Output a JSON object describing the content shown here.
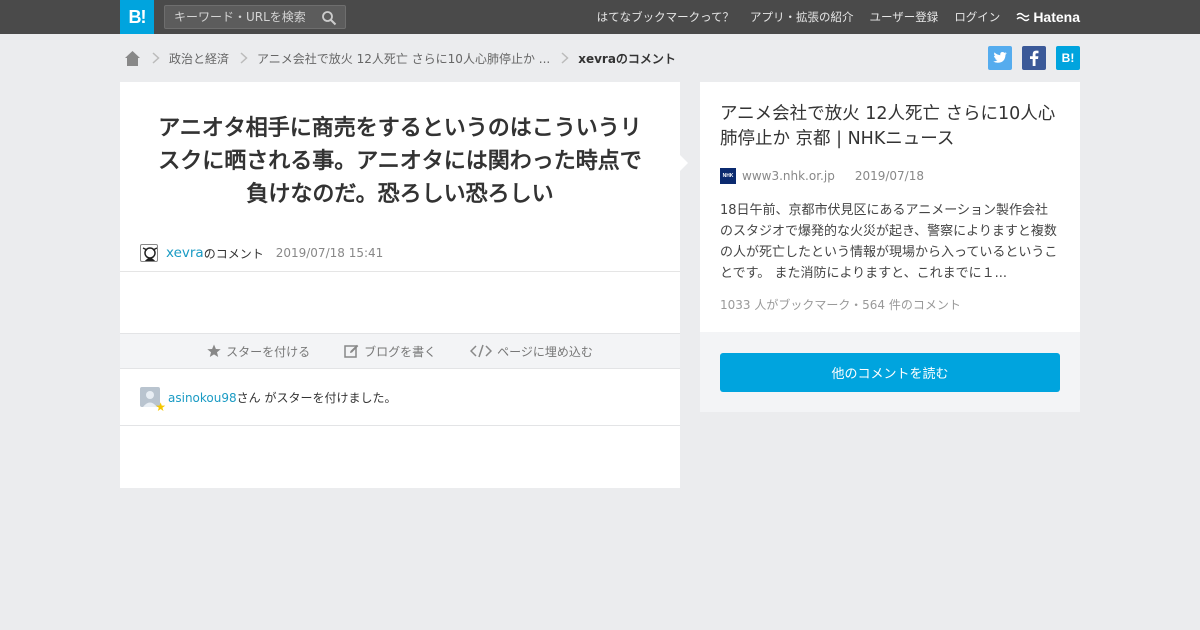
{
  "topbar": {
    "logo": "B!",
    "search_placeholder": "キーワード・URLを検索",
    "nav": [
      "はてなブックマークって？",
      "アプリ・拡張の紹介",
      "ユーザー登録",
      "ログイン"
    ],
    "brand": "Hatena"
  },
  "breadcrumb": {
    "items": [
      "政治と経済",
      "アニメ会社で放火 12人死亡 さらに10人心肺停止か ...",
      "xevraのコメント"
    ]
  },
  "share": {
    "twitter": "t",
    "facebook": "f",
    "hatena": "B!"
  },
  "comment": {
    "text": "アニオタ相手に商売をするというのはこういうリスクに晒される事。アニオタには関わった時点で負けなのだ。恐ろしい恐ろしい",
    "user": "xevra",
    "user_suffix": "のコメント",
    "timestamp": "2019/07/18 15:41"
  },
  "actions": {
    "star": "スターを付ける",
    "blog": "ブログを書く",
    "embed": "ページに埋め込む"
  },
  "stars": {
    "user": "asinokou98",
    "text": "さん がスターを付けました。"
  },
  "entry": {
    "title": "アニメ会社で放火 12人死亡 さらに10人心肺停止か 京都 | NHKニュース",
    "domain": "www3.nhk.or.jp",
    "date": "2019/07/18",
    "favicon": "NHK",
    "summary": "18日午前、京都市伏見区にあるアニメーション製作会社のスタジオで爆発的な火災が起き、警察によりますと複数の人が死亡したという情報が現場から入っているということです。 また消防によりますと、これまでに１...",
    "counts": "1033 人がブックマーク・564 件のコメント",
    "read_more": "他のコメントを読む"
  },
  "colors": {
    "accent": "#00a4de",
    "topbar": "#4a4a4a",
    "background": "#ebecee"
  }
}
